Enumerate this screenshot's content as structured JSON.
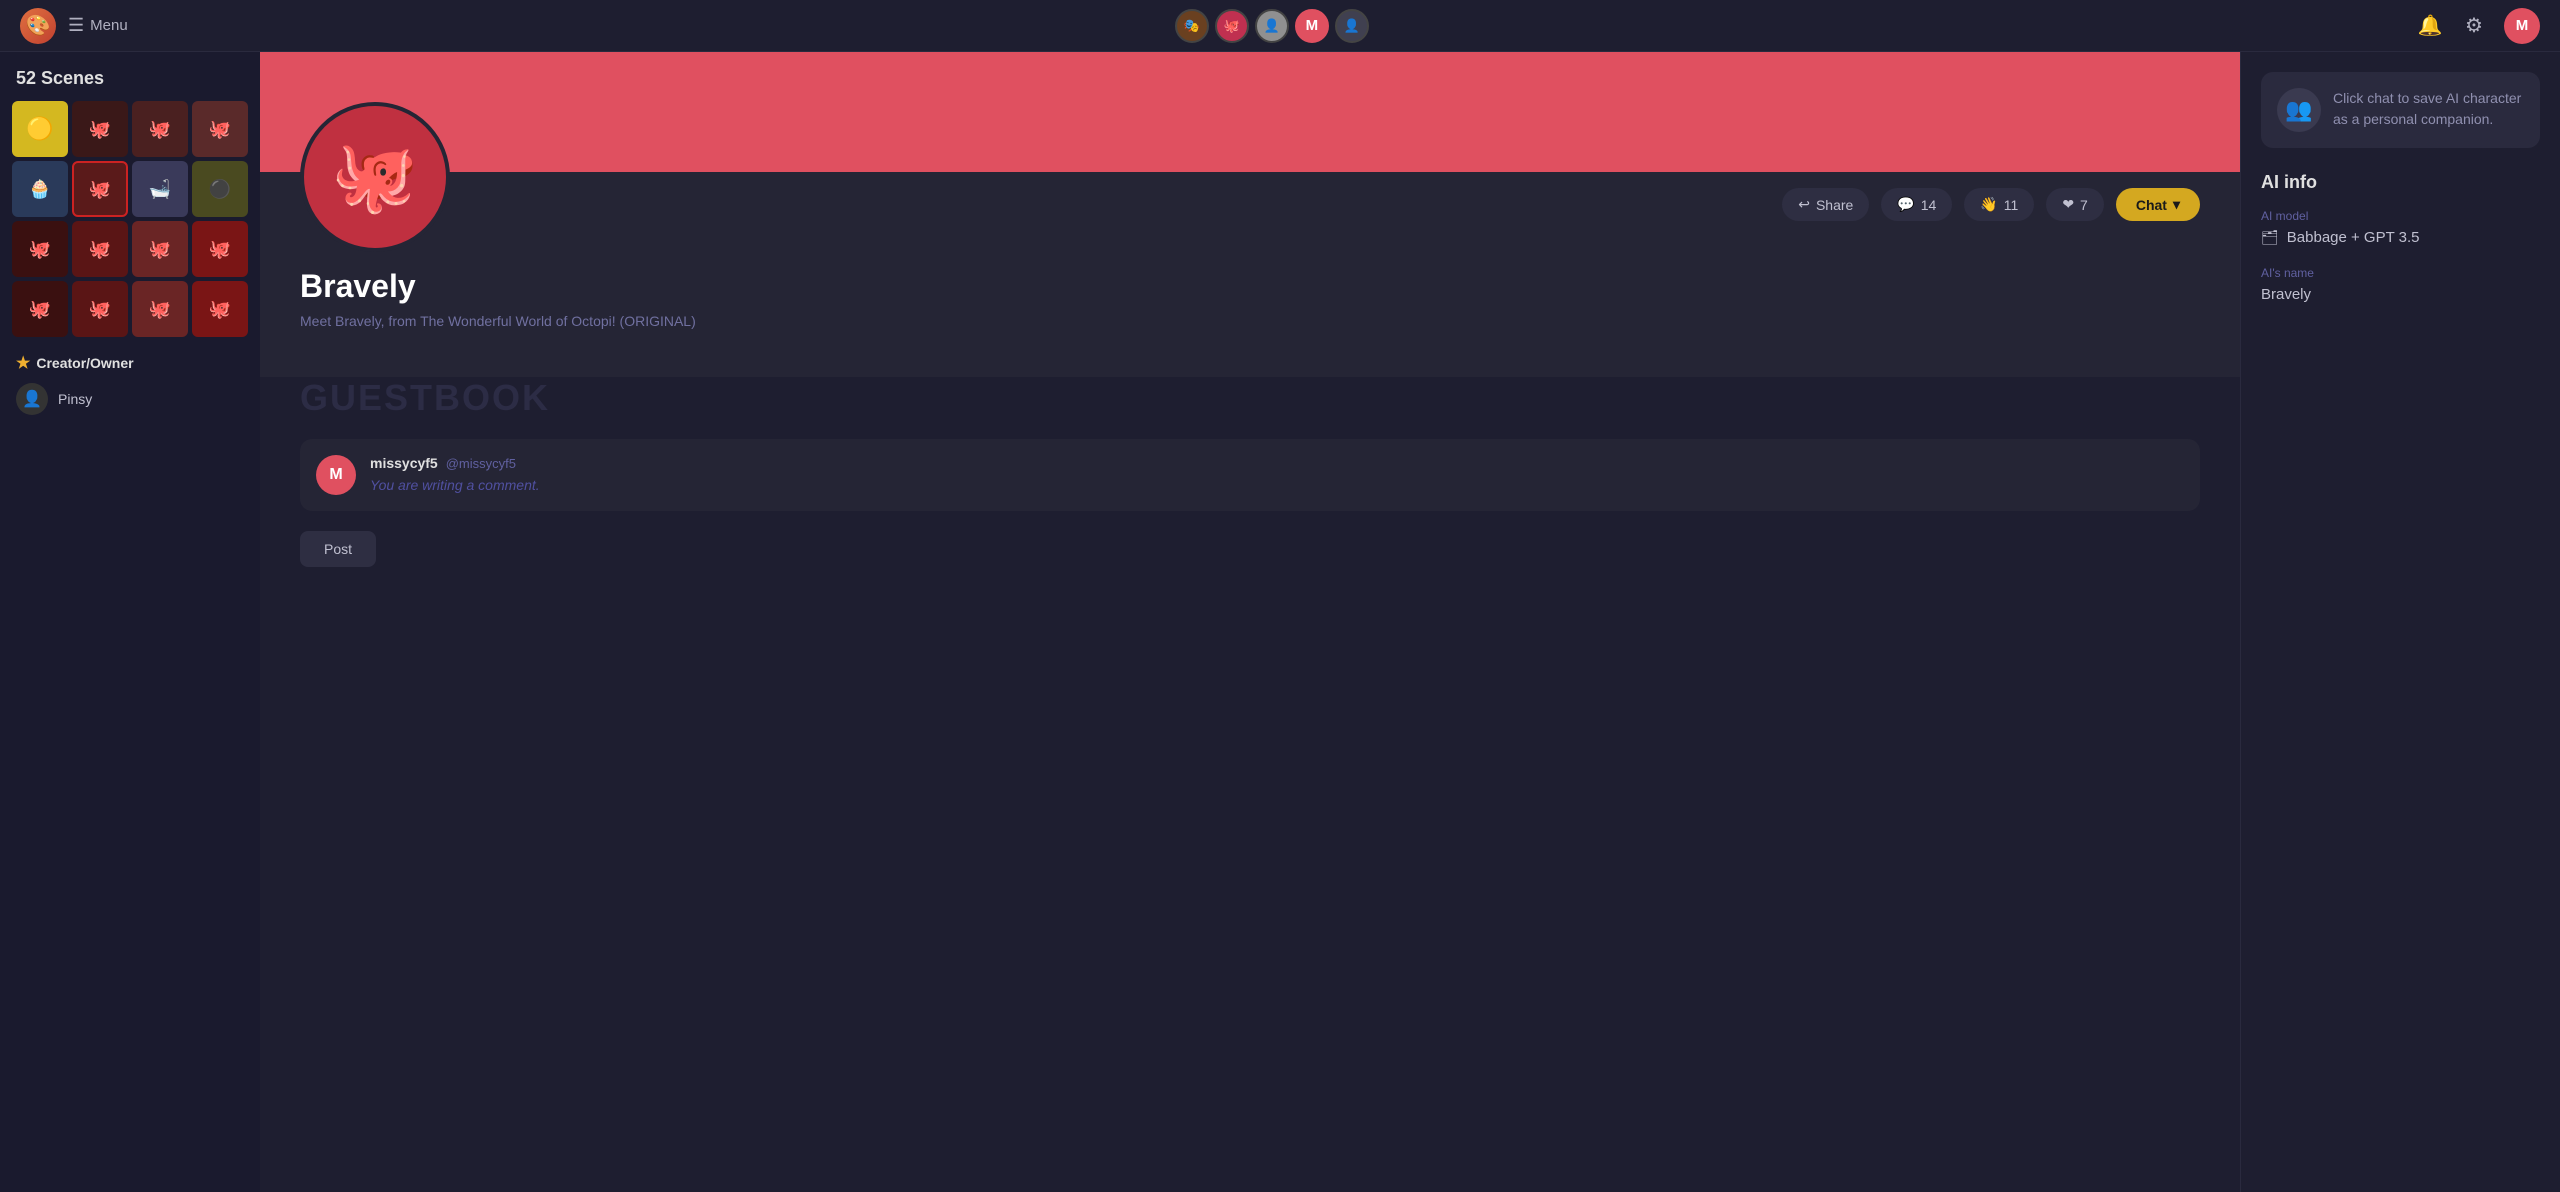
{
  "topnav": {
    "logo_emoji": "🎨",
    "menu_label": "Menu",
    "user_initial": "M",
    "nav_users": [
      {
        "id": "u1",
        "bg": "#6a4020",
        "initial": ""
      },
      {
        "id": "u2",
        "bg": "#c03050",
        "initial": ""
      },
      {
        "id": "u3",
        "bg": "#909090",
        "initial": ""
      },
      {
        "id": "u4",
        "bg": "#e05060",
        "initial": "M"
      },
      {
        "id": "u5",
        "bg": "#404050",
        "initial": ""
      }
    ],
    "notification_icon": "🔔",
    "settings_icon": "⚙"
  },
  "sidebar": {
    "scenes_title": "52 Scenes",
    "scenes": [
      {
        "color": "scene-yellow",
        "emoji": "🟡"
      },
      {
        "color": "scene-red-dark",
        "emoji": "🐙"
      },
      {
        "color": "scene-red-med",
        "emoji": "🐙"
      },
      {
        "color": "scene-red-light",
        "emoji": "🐙"
      },
      {
        "color": "scene-blue",
        "emoji": "🧁"
      },
      {
        "color": "scene-red-bright",
        "emoji": "🐙"
      },
      {
        "color": "scene-bath",
        "emoji": "🛁"
      },
      {
        "color": "scene-olive",
        "emoji": "⚫"
      },
      {
        "color": "scene-dark-red",
        "emoji": "🐙"
      },
      {
        "color": "scene-med-red",
        "emoji": "🐙"
      },
      {
        "color": "scene-rose",
        "emoji": "🐙"
      },
      {
        "color": "scene-crimson",
        "emoji": "🐙"
      },
      {
        "color": "scene-dark-red",
        "emoji": "🐙"
      },
      {
        "color": "scene-med-red",
        "emoji": "🐙"
      },
      {
        "color": "scene-rose",
        "emoji": "🐙"
      },
      {
        "color": "scene-crimson",
        "emoji": "🐙"
      }
    ],
    "creator_label": "Creator/Owner",
    "creator_name": "Pinsy",
    "creator_emoji": "👤"
  },
  "character": {
    "name": "Bravely",
    "description": "Meet Bravely, from The Wonderful World of Octopi! (ORIGINAL)",
    "share_label": "Share",
    "share_count": "14",
    "wave_count": "11",
    "heart_count": "7",
    "chat_label": "Chat",
    "emoji": "🐙"
  },
  "guestbook": {
    "title": "GUESTBOOK",
    "comment_username": "missycyf5",
    "comment_handle": "@missycyf5",
    "comment_initial": "M",
    "comment_placeholder": "You are writing a comment.",
    "post_label": "Post"
  },
  "right_panel": {
    "companion_hint": "Click chat to save AI character as a personal companion.",
    "companion_icon": "👥",
    "ai_info_title": "AI info",
    "ai_model_label": "AI model",
    "ai_model_icon": "🗂",
    "ai_model_value": "Babbage + GPT 3.5",
    "ai_name_label": "AI's name",
    "ai_name_value": "Bravely"
  }
}
